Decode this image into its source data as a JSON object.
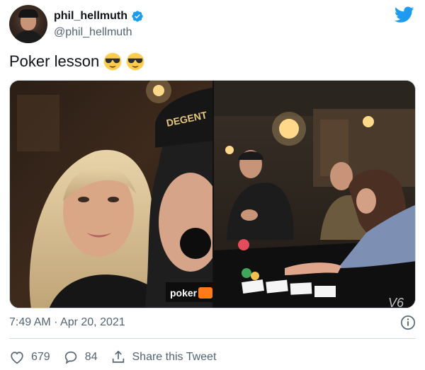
{
  "tweet": {
    "author_name": "phil_hellmuth",
    "author_handle": "@phil_hellmuth",
    "text": "Poker lesson",
    "timestamp": "7:49 AM · Apr 20, 2021",
    "likes": "679",
    "replies": "84",
    "share_label": "Share this Tweet",
    "verified": true
  },
  "media": {
    "photo_count": 2,
    "left_photo": {
      "cap_text": "DEGENT",
      "shirt_logo": "poker"
    },
    "right_photo": {
      "table_text": "V6"
    }
  },
  "icons": {
    "brand": "twitter-bird-icon",
    "verified": "verified-badge-icon",
    "emoji": "sunglasses-face-emoji",
    "info": "info-icon",
    "like": "heart-icon",
    "reply": "reply-bubble-icon",
    "share": "share-icon"
  },
  "colors": {
    "twitter_blue": "#1d9bf0",
    "text_primary": "#0f1419",
    "text_secondary": "#536471",
    "border": "#cfd9de"
  }
}
